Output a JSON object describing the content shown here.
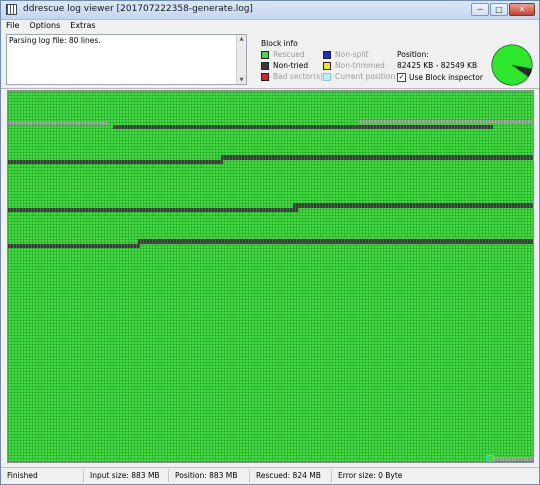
{
  "window": {
    "title": "ddrescue log viewer [201707222358-generate.log]",
    "controls": [
      "─",
      "□",
      "✕"
    ]
  },
  "menu": {
    "items": [
      "File",
      "Options",
      "Extras"
    ]
  },
  "log": {
    "text": "Parsing log file: 80 lines."
  },
  "block_info": {
    "title": "Block info",
    "legend": [
      {
        "label": "Rescued",
        "color": "#44d944",
        "dim": true
      },
      {
        "label": "Non-tried",
        "color": "#3b3b3b",
        "dim": false
      },
      {
        "label": "Bad sector(s)",
        "color": "#dd2222",
        "dim": true
      },
      {
        "label": "Non-split",
        "color": "#1a2ccc",
        "dim": true
      },
      {
        "label": "Non-trimmed",
        "color": "#f2e21a",
        "dim": true
      },
      {
        "label": "Current position",
        "color": "#bff0f0",
        "dim": true
      }
    ],
    "position_label": "Position:",
    "position_value": "82425 KB - 82549 KB",
    "inspector_label": "Use Block inspector",
    "inspector_checked": true,
    "rescued_fraction": 0.93
  },
  "status": {
    "state": "Finished",
    "input_size": "Input size: 883 MB",
    "position": "Position: 883 MB",
    "rescued": "Rescued: 824 MB",
    "error_size": "Error size: 0 Byte"
  },
  "colors": {
    "rescued": "#44d944",
    "non_tried": "#3b3b3b",
    "accent": "#6b8db7"
  }
}
